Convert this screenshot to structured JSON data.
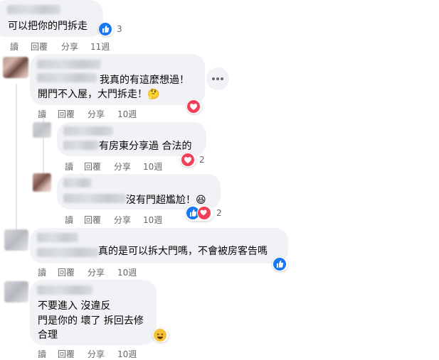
{
  "comments": [
    {
      "id": "c1",
      "text_lines": [
        "可以把你的門拆走"
      ],
      "reaction_count": "3",
      "actions": {
        "reply": "回覆",
        "share": "分享",
        "read": "讀",
        "time": "11週"
      }
    },
    {
      "id": "c2",
      "text_lines": [
        "我真的有這麼想過！",
        "開門不入屋，大門拆走！🤔"
      ],
      "reaction_count": "",
      "actions": {
        "reply": "回覆",
        "share": "分享",
        "read": "讀",
        "time": "10週"
      }
    },
    {
      "id": "c3",
      "text_lines": [
        "有房東分享過 合法的"
      ],
      "reaction_count": "2",
      "actions": {
        "reply": "回覆",
        "share": "分享",
        "read": "讀",
        "time": "10週"
      }
    },
    {
      "id": "c4",
      "text_lines": [
        "沒有門超尷尬！😆"
      ],
      "reaction_count": "2",
      "actions": {
        "reply": "回覆",
        "share": "分享",
        "read": "讀",
        "time": "10週"
      }
    },
    {
      "id": "c5",
      "text_lines": [
        "真的是可以拆大門嗎，不會被房客告嗎"
      ],
      "reaction_count": "",
      "actions": {
        "reply": "回覆",
        "share": "分享",
        "read": "讀",
        "time": "10週"
      }
    },
    {
      "id": "c6",
      "text_lines": [
        "不要進入 沒違反",
        "門是你的 壞了 拆回去修",
        "合理"
      ],
      "reaction_count": "",
      "actions": {
        "reply": "回覆",
        "share": "分享",
        "read": "讀",
        "time": "10週"
      }
    }
  ],
  "colors": {
    "bubble": "#f0f2f5",
    "meta": "#65676b",
    "like": "#1877f2",
    "love": "#f33e58",
    "haha": "#f7c136"
  },
  "icons": {
    "like": "thumbs-up-icon",
    "love": "heart-icon",
    "haha": "laughing-face-icon",
    "more": "more-horizontal-icon"
  }
}
